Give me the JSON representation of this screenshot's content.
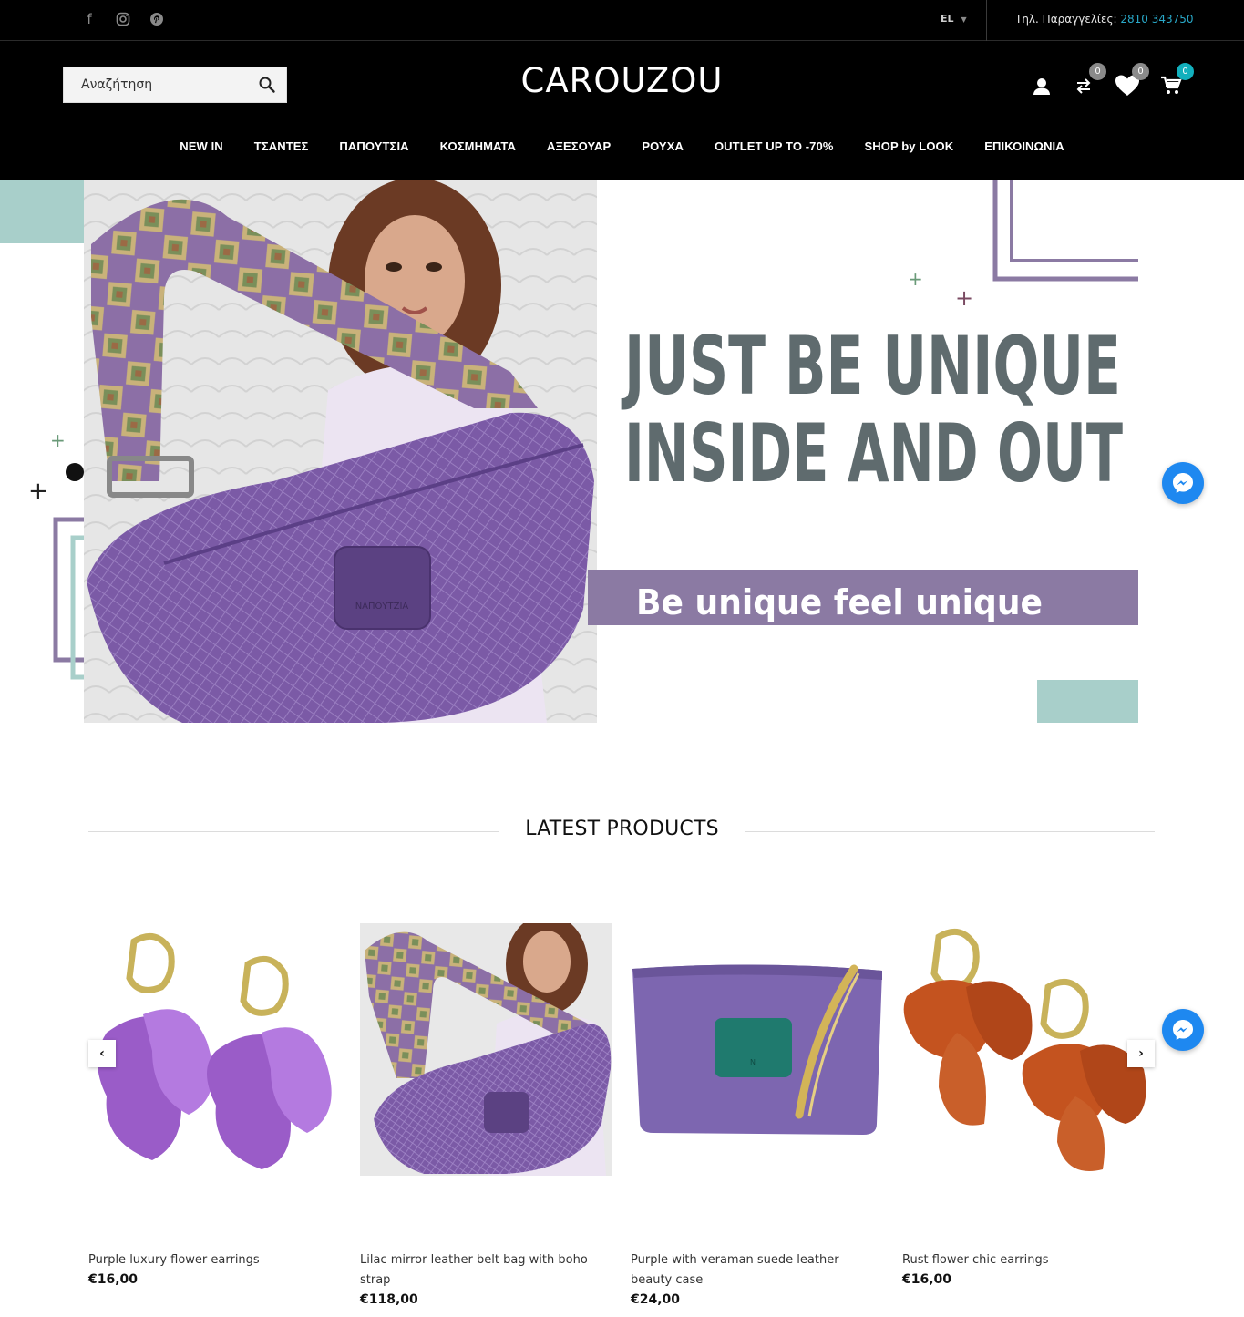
{
  "topbar": {
    "social": [
      {
        "icon": "facebook-icon",
        "glyph": "f"
      },
      {
        "icon": "instagram-icon",
        "glyph": "◎"
      },
      {
        "icon": "pinterest-icon",
        "glyph": "℗"
      }
    ],
    "language": "EL",
    "phone_label": "Τηλ. Παραγγελίες:",
    "phone_number": "2810 343750"
  },
  "header": {
    "logo": "CAROUZOU",
    "search_placeholder": "Αναζήτηση",
    "compare_count": "0",
    "wishlist_count": "0",
    "cart_count": "0"
  },
  "nav": {
    "items": [
      "NEW IN",
      "ΤΣΑΝΤΕΣ",
      "ΠΑΠΟΥΤΣΙΑ",
      "ΚΟΣΜΗΜΑΤΑ",
      "ΑΞΕΣΟΥΑΡ",
      "ΡΟΥΧΑ",
      "OUTLET UP TO -70%",
      "SHOP by LOOK",
      "ΕΠΙΚΟΙΝΩΝΙΑ"
    ]
  },
  "hero": {
    "headline_1": "JUST BE UNIQUE",
    "headline_2": "INSIDE AND OUT",
    "tagline": "Be unique feel unique",
    "bag_stamp": "ΝΑΠΟΥΤΖΙΑ"
  },
  "latest": {
    "title": "LATEST PRODUCTS",
    "products": [
      {
        "name": "Purple luxury flower earrings",
        "price": "€16,00"
      },
      {
        "name": "Lilac mirror leather belt bag with boho strap",
        "price": "€118,00"
      },
      {
        "name": "Purple with veraman suede leather beauty case",
        "price": "€24,00"
      },
      {
        "name": "Rust flower chic earrings",
        "price": "€16,00"
      }
    ]
  },
  "colors": {
    "accent_blue": "#29a9c9",
    "badge_grey": "#8a8a8a",
    "badge_teal": "#12b0bd",
    "lavender": "#8b7aa3",
    "mint": "#a8cfca",
    "slate_text": "#5f6b6e",
    "messenger": "#1e88f0"
  }
}
